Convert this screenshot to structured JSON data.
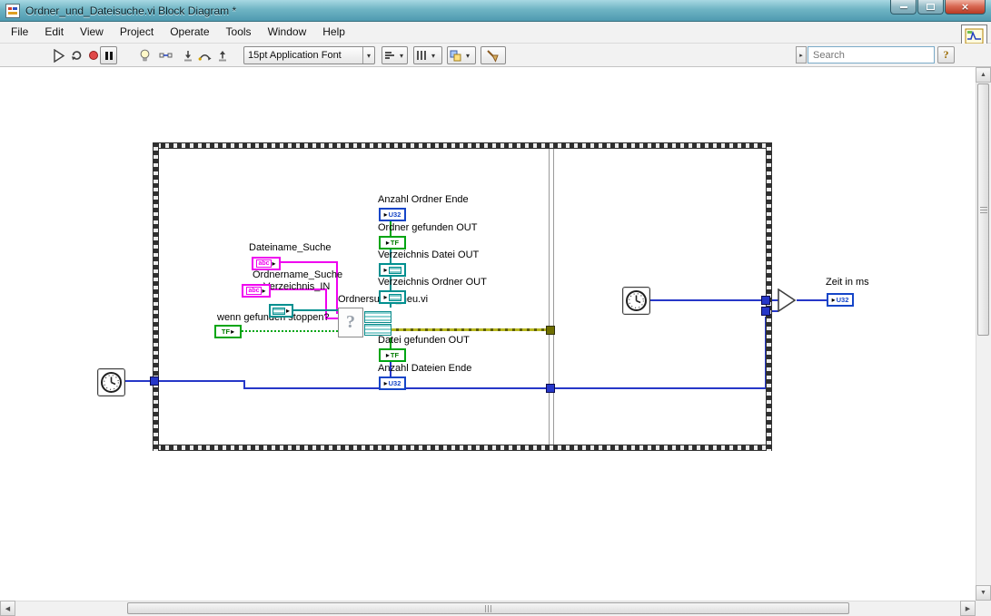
{
  "window": {
    "title": "Ordner_und_Dateisuche.vi Block Diagram *"
  },
  "menus": {
    "file": "File",
    "edit": "Edit",
    "view": "View",
    "project": "Project",
    "operate": "Operate",
    "tools": "Tools",
    "window": "Window",
    "help": "Help"
  },
  "toolbar": {
    "font_label": "15pt Application Font",
    "search_placeholder": "Search",
    "help_label": "?"
  },
  "icons": {
    "caret": "▾",
    "up": "▲",
    "down": "▼",
    "left": "◀",
    "right": "▶",
    "term_arrow": "▸",
    "search_arrow": "▸",
    "close": "×"
  },
  "diagram": {
    "labels": {
      "dateiname": "Dateiname_Suche",
      "ordnername": "Ordnername_Suche",
      "verzeichnis": "Verzeichnis_IN",
      "stop": "wenn gefunden stoppen?",
      "subvi": "Ordnersuche_neu.vi",
      "anzahl_ordner": "Anzahl Ordner Ende",
      "ordner_gefunden": "Ordner gefunden OUT",
      "verzeichnis_datei": "Verzeichnis Datei OUT",
      "verzeichnis_ordner": "Verzeichnis Ordner OUT",
      "datei_gefunden": "Datei gefunden OUT",
      "anzahl_dateien": "Anzahl Dateien Ende",
      "zeit": "Zeit in ms"
    },
    "glyphs": {
      "u32": "U32",
      "tf": "TF",
      "abc": "abc",
      "question": "?"
    }
  }
}
